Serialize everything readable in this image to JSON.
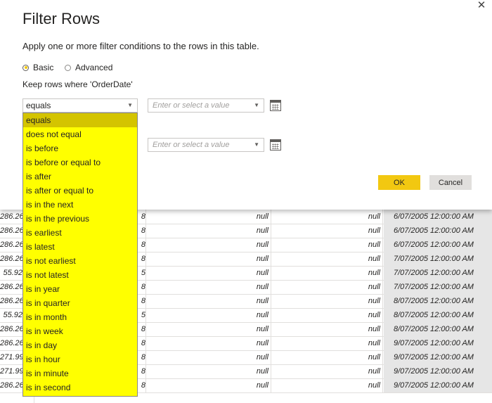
{
  "dialog": {
    "title": "Filter Rows",
    "subtitle": "Apply one or more filter conditions to the rows in this table.",
    "radio_basic": "Basic",
    "radio_advanced": "Advanced",
    "keep_rows_label": "Keep rows where 'OrderDate'",
    "operator_value": "equals",
    "value_placeholder": "Enter or select a value",
    "ok_label": "OK",
    "cancel_label": "Cancel",
    "close_glyph": "✕"
  },
  "dropdown_options": [
    "equals",
    "does not equal",
    "is before",
    "is before or equal to",
    "is after",
    "is after or equal to",
    "is in the next",
    "is in the previous",
    "is earliest",
    "is latest",
    "is not earliest",
    "is not latest",
    "is in year",
    "is in quarter",
    "is in month",
    "is in week",
    "is in day",
    "is in hour",
    "is in minute",
    "is in second"
  ],
  "grid_rows": [
    {
      "a": "286.26",
      "b": "8",
      "c": "null",
      "d": "null",
      "e": "6/07/2005 12:00:00 AM"
    },
    {
      "a": "286.26",
      "b": "8",
      "c": "null",
      "d": "null",
      "e": "6/07/2005 12:00:00 AM"
    },
    {
      "a": "286.26",
      "b": "8",
      "c": "null",
      "d": "null",
      "e": "6/07/2005 12:00:00 AM"
    },
    {
      "a": "286.26",
      "b": "8",
      "c": "null",
      "d": "null",
      "e": "7/07/2005 12:00:00 AM"
    },
    {
      "a": "55.92",
      "b": "5",
      "c": "null",
      "d": "null",
      "e": "7/07/2005 12:00:00 AM"
    },
    {
      "a": "286.26",
      "b": "8",
      "c": "null",
      "d": "null",
      "e": "7/07/2005 12:00:00 AM"
    },
    {
      "a": "286.26",
      "b": "8",
      "c": "null",
      "d": "null",
      "e": "8/07/2005 12:00:00 AM"
    },
    {
      "a": "55.92",
      "b": "5",
      "c": "null",
      "d": "null",
      "e": "8/07/2005 12:00:00 AM"
    },
    {
      "a": "286.26",
      "b": "8",
      "c": "null",
      "d": "null",
      "e": "8/07/2005 12:00:00 AM"
    },
    {
      "a": "286.26",
      "b": "8",
      "c": "null",
      "d": "null",
      "e": "9/07/2005 12:00:00 AM"
    },
    {
      "a": "271.99",
      "b": "8",
      "c": "null",
      "d": "null",
      "e": "9/07/2005 12:00:00 AM"
    },
    {
      "a": "271.99",
      "b": "8",
      "c": "null",
      "d": "null",
      "e": "9/07/2005 12:00:00 AM"
    },
    {
      "a": "286.26",
      "b": "8",
      "c": "null",
      "d": "null",
      "e": "9/07/2005 12:00:00 AM"
    }
  ],
  "colors": {
    "accent": "#f2c811",
    "dropdown_bg": "#ffff00",
    "dropdown_selected": "#d4c400"
  }
}
